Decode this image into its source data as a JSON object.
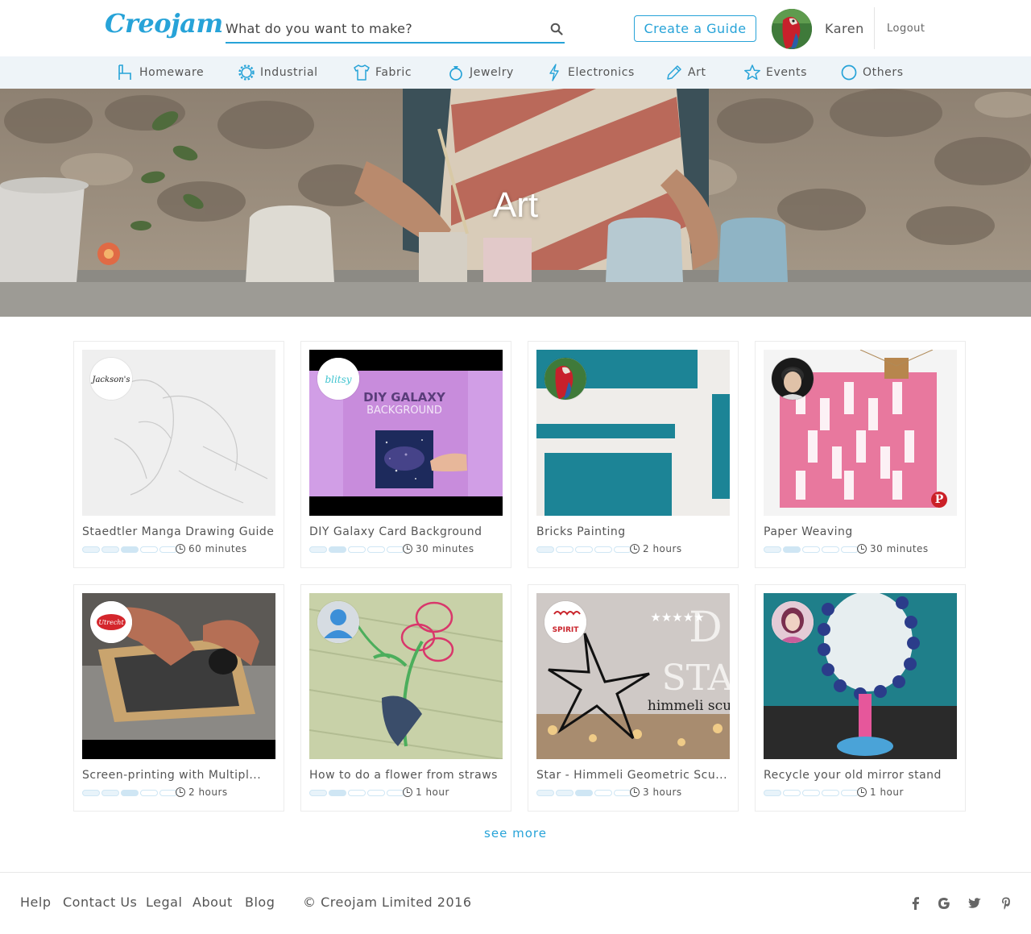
{
  "brand": {
    "logo": "Creojam"
  },
  "search": {
    "placeholder": "What do you want to make?"
  },
  "header": {
    "create_label": "Create a Guide",
    "username": "Karen",
    "logout_label": "Logout"
  },
  "categories": [
    {
      "label": "Homeware",
      "icon": "chair-icon"
    },
    {
      "label": "Industrial",
      "icon": "gear-icon"
    },
    {
      "label": "Fabric",
      "icon": "shirt-icon"
    },
    {
      "label": "Jewelry",
      "icon": "ring-icon"
    },
    {
      "label": "Electronics",
      "icon": "lightning-icon"
    },
    {
      "label": "Art",
      "icon": "pencil-icon"
    },
    {
      "label": "Events",
      "icon": "star-icon"
    },
    {
      "label": "Others",
      "icon": "circle-icon"
    }
  ],
  "hero": {
    "title": "Art"
  },
  "guides": [
    {
      "title": "Staedtler Manga Drawing Guide",
      "duration": "60 minutes",
      "difficulty": 3,
      "author_badge": "Jackson's"
    },
    {
      "title": "DIY Galaxy Card Background",
      "duration": "30 minutes",
      "difficulty": 2,
      "author_badge": "blitsy",
      "image_text_1": "DIY GALAXY",
      "image_text_2": "BACKGROUND"
    },
    {
      "title": "Bricks Painting",
      "duration": "2 hours",
      "difficulty": 1
    },
    {
      "title": "Paper Weaving",
      "duration": "30 minutes",
      "difficulty": 2
    },
    {
      "title": "Screen-printing with Multipl...",
      "duration": "2 hours",
      "difficulty": 3,
      "author_badge": "Utrecht"
    },
    {
      "title": "How to do a flower from straws",
      "duration": "1 hour",
      "difficulty": 2
    },
    {
      "title": "Star - Himmeli Geometric Scu...",
      "duration": "3 hours",
      "difficulty": 3,
      "author_badge": "SPIRIT",
      "image_text_1": "★★★★★",
      "image_text_2": "himmeli scu"
    },
    {
      "title": "Recycle your old mirror stand",
      "duration": "1 hour",
      "difficulty": 1
    }
  ],
  "see_more": "see more",
  "footer": {
    "links": [
      "Help",
      "Contact Us",
      "Legal",
      "About",
      "Blog"
    ],
    "copyright": "© Creojam Limited 2016",
    "social": [
      "facebook-icon",
      "google-icon",
      "twitter-icon",
      "pinterest-icon"
    ]
  },
  "colors": {
    "accent": "#27a3d8",
    "nav_bg": "#eef4f8",
    "difficulty": "#cfe6f4"
  }
}
